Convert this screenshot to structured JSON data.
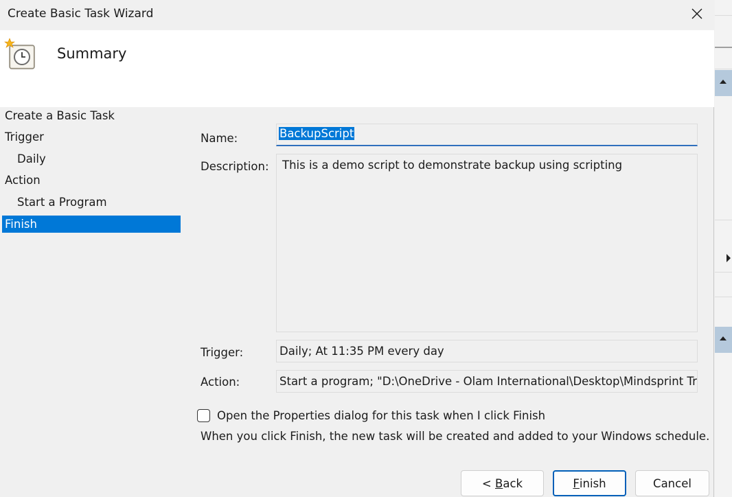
{
  "window": {
    "title": "Create Basic Task Wizard"
  },
  "header": {
    "heading": "Summary",
    "icon": "task-clock-icon"
  },
  "steps": [
    {
      "label": "Create a Basic Task"
    },
    {
      "label": "Trigger"
    },
    {
      "label": "Daily"
    },
    {
      "label": "Action"
    },
    {
      "label": "Start a Program"
    },
    {
      "label": "Finish"
    }
  ],
  "form": {
    "name_label": "Name:",
    "name_value": "BackupScript",
    "description_label": "Description:",
    "description_value": "This is a demo script to demonstrate backup using scripting",
    "trigger_label": "Trigger:",
    "trigger_value": "Daily; At 11:35 PM every day",
    "action_label": "Action:",
    "action_value": "Start a program; \"D:\\OneDrive - Olam International\\Desktop\\Mindsprint Training"
  },
  "options": {
    "open_properties_label": "Open the Properties dialog for this task when I click Finish",
    "open_properties_checked": false,
    "info_text": "When you click Finish, the new task will be created and added to your Windows schedule."
  },
  "buttons": {
    "back_prefix": "< ",
    "back_hotkey": "B",
    "back_rest": "ack",
    "finish_hotkey": "F",
    "finish_rest": "inish",
    "cancel": "Cancel"
  },
  "colors": {
    "accent": "#0078d7",
    "background": "#f0f0f0"
  }
}
